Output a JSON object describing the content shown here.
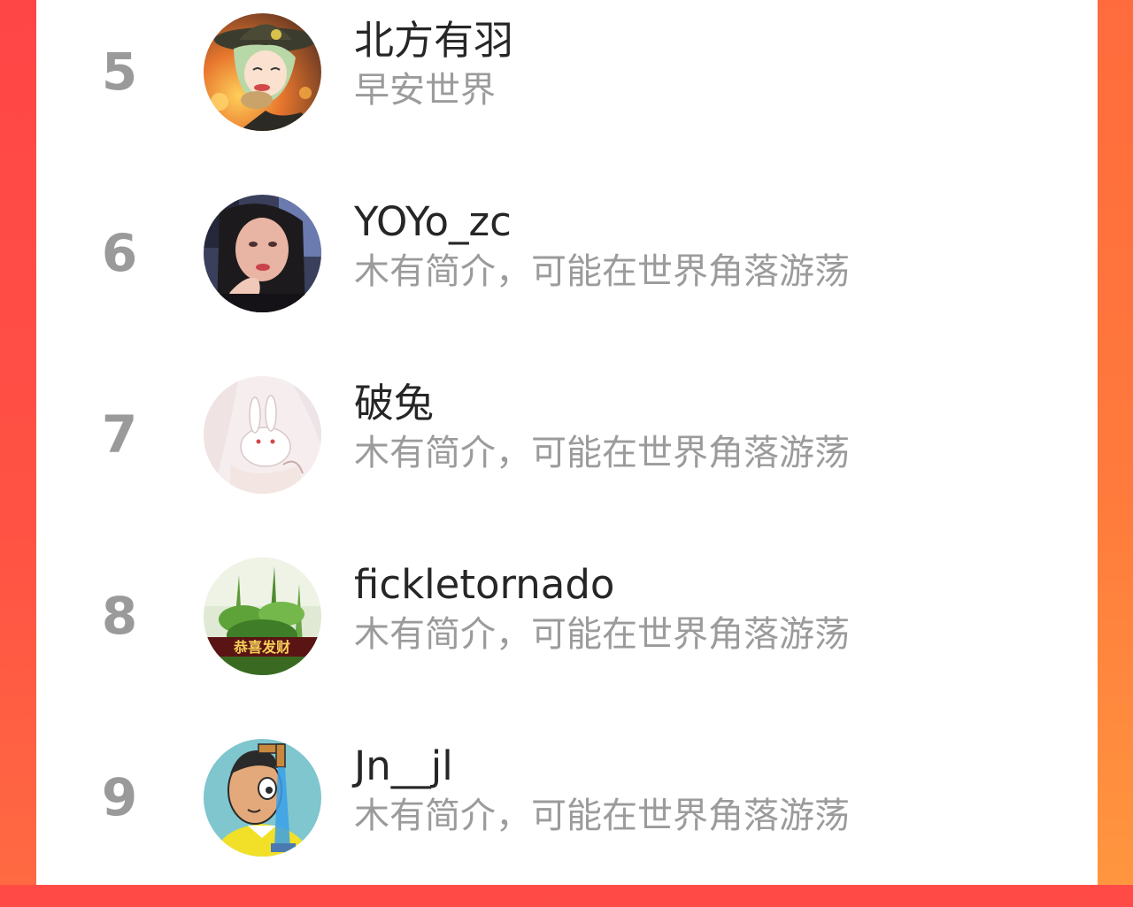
{
  "colors": {
    "accent_left": "#ff4a45",
    "accent_right": "#ff8a3e",
    "rank_text": "#9a9a9a",
    "name_text": "#262626",
    "bio_text": "#9b9b9b"
  },
  "leaderboard": {
    "rows": [
      {
        "rank": "5",
        "name": "北方有羽",
        "bio": "早安世界",
        "avatar_icon": "anime-girl-avatar"
      },
      {
        "rank": "6",
        "name": "YOYo_zc",
        "bio": "木有简介，可能在世界角落游荡",
        "avatar_icon": "selfie-photo-avatar"
      },
      {
        "rank": "7",
        "name": "破兔",
        "bio": "木有简介，可能在世界角落游荡",
        "avatar_icon": "rabbit-illustration-avatar"
      },
      {
        "rank": "8",
        "name": "fickletornado",
        "bio": "木有简介，可能在世界角落游荡",
        "avatar_icon": "plant-avatar",
        "avatar_caption": "恭喜发财"
      },
      {
        "rank": "9",
        "name": "Jn__jl",
        "bio": "木有简介，可能在世界角落游荡",
        "avatar_icon": "cartoon-man-avatar"
      }
    ]
  }
}
